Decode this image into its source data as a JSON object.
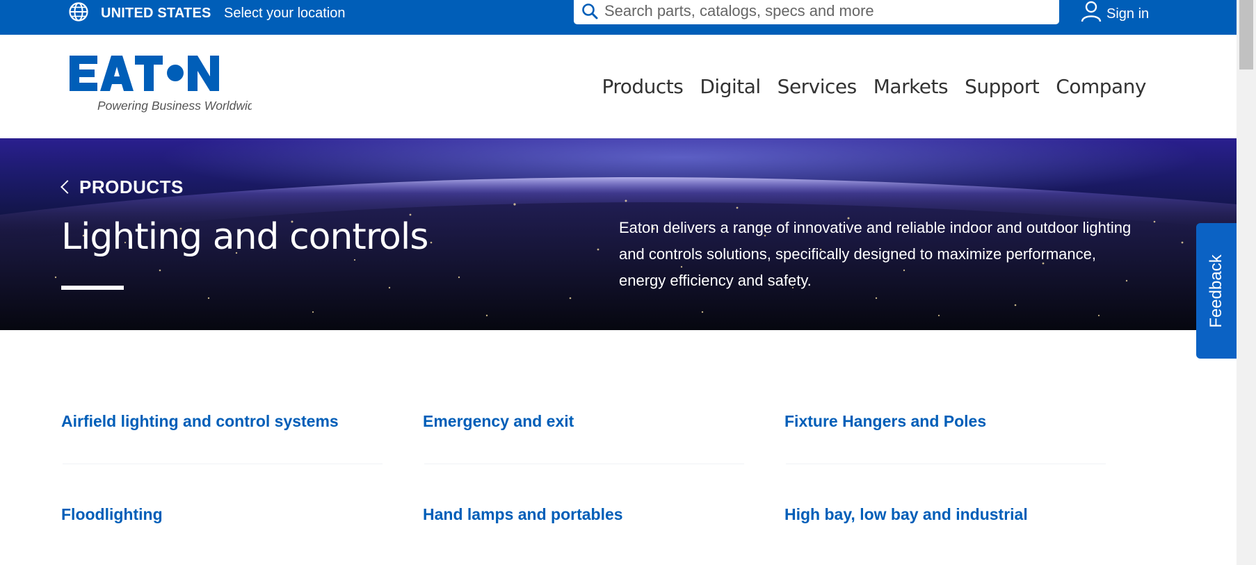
{
  "topbar": {
    "country": "UNITED STATES",
    "location_link": "Select your location",
    "search_placeholder": "Search parts, catalogs, specs and more",
    "signin_label": "Sign in"
  },
  "header": {
    "logo_text": "EATON",
    "logo_tagline": "Powering Business Worldwide",
    "nav": [
      "Products",
      "Digital",
      "Services",
      "Markets",
      "Support",
      "Company"
    ]
  },
  "hero": {
    "back_label": "PRODUCTS",
    "title": "Lighting and controls",
    "description": "Eaton delivers a range of innovative and reliable indoor and outdoor lighting and controls solutions, specifically designed to maximize performance, energy efficiency and safety."
  },
  "feedback_label": "Feedback",
  "categories": [
    "Airfield lighting and control systems",
    "Emergency and exit",
    "Fixture Hangers and Poles",
    "Floodlighting",
    "Hand lamps and portables",
    "High bay, low bay and industrial"
  ],
  "colors": {
    "brand_blue": "#005eb8",
    "link_blue": "#005eb8",
    "feedback_blue": "#0b62c4"
  },
  "icons": {
    "globe": "globe-icon",
    "search": "search-icon",
    "user": "user-icon",
    "back": "chevron-left-icon"
  }
}
